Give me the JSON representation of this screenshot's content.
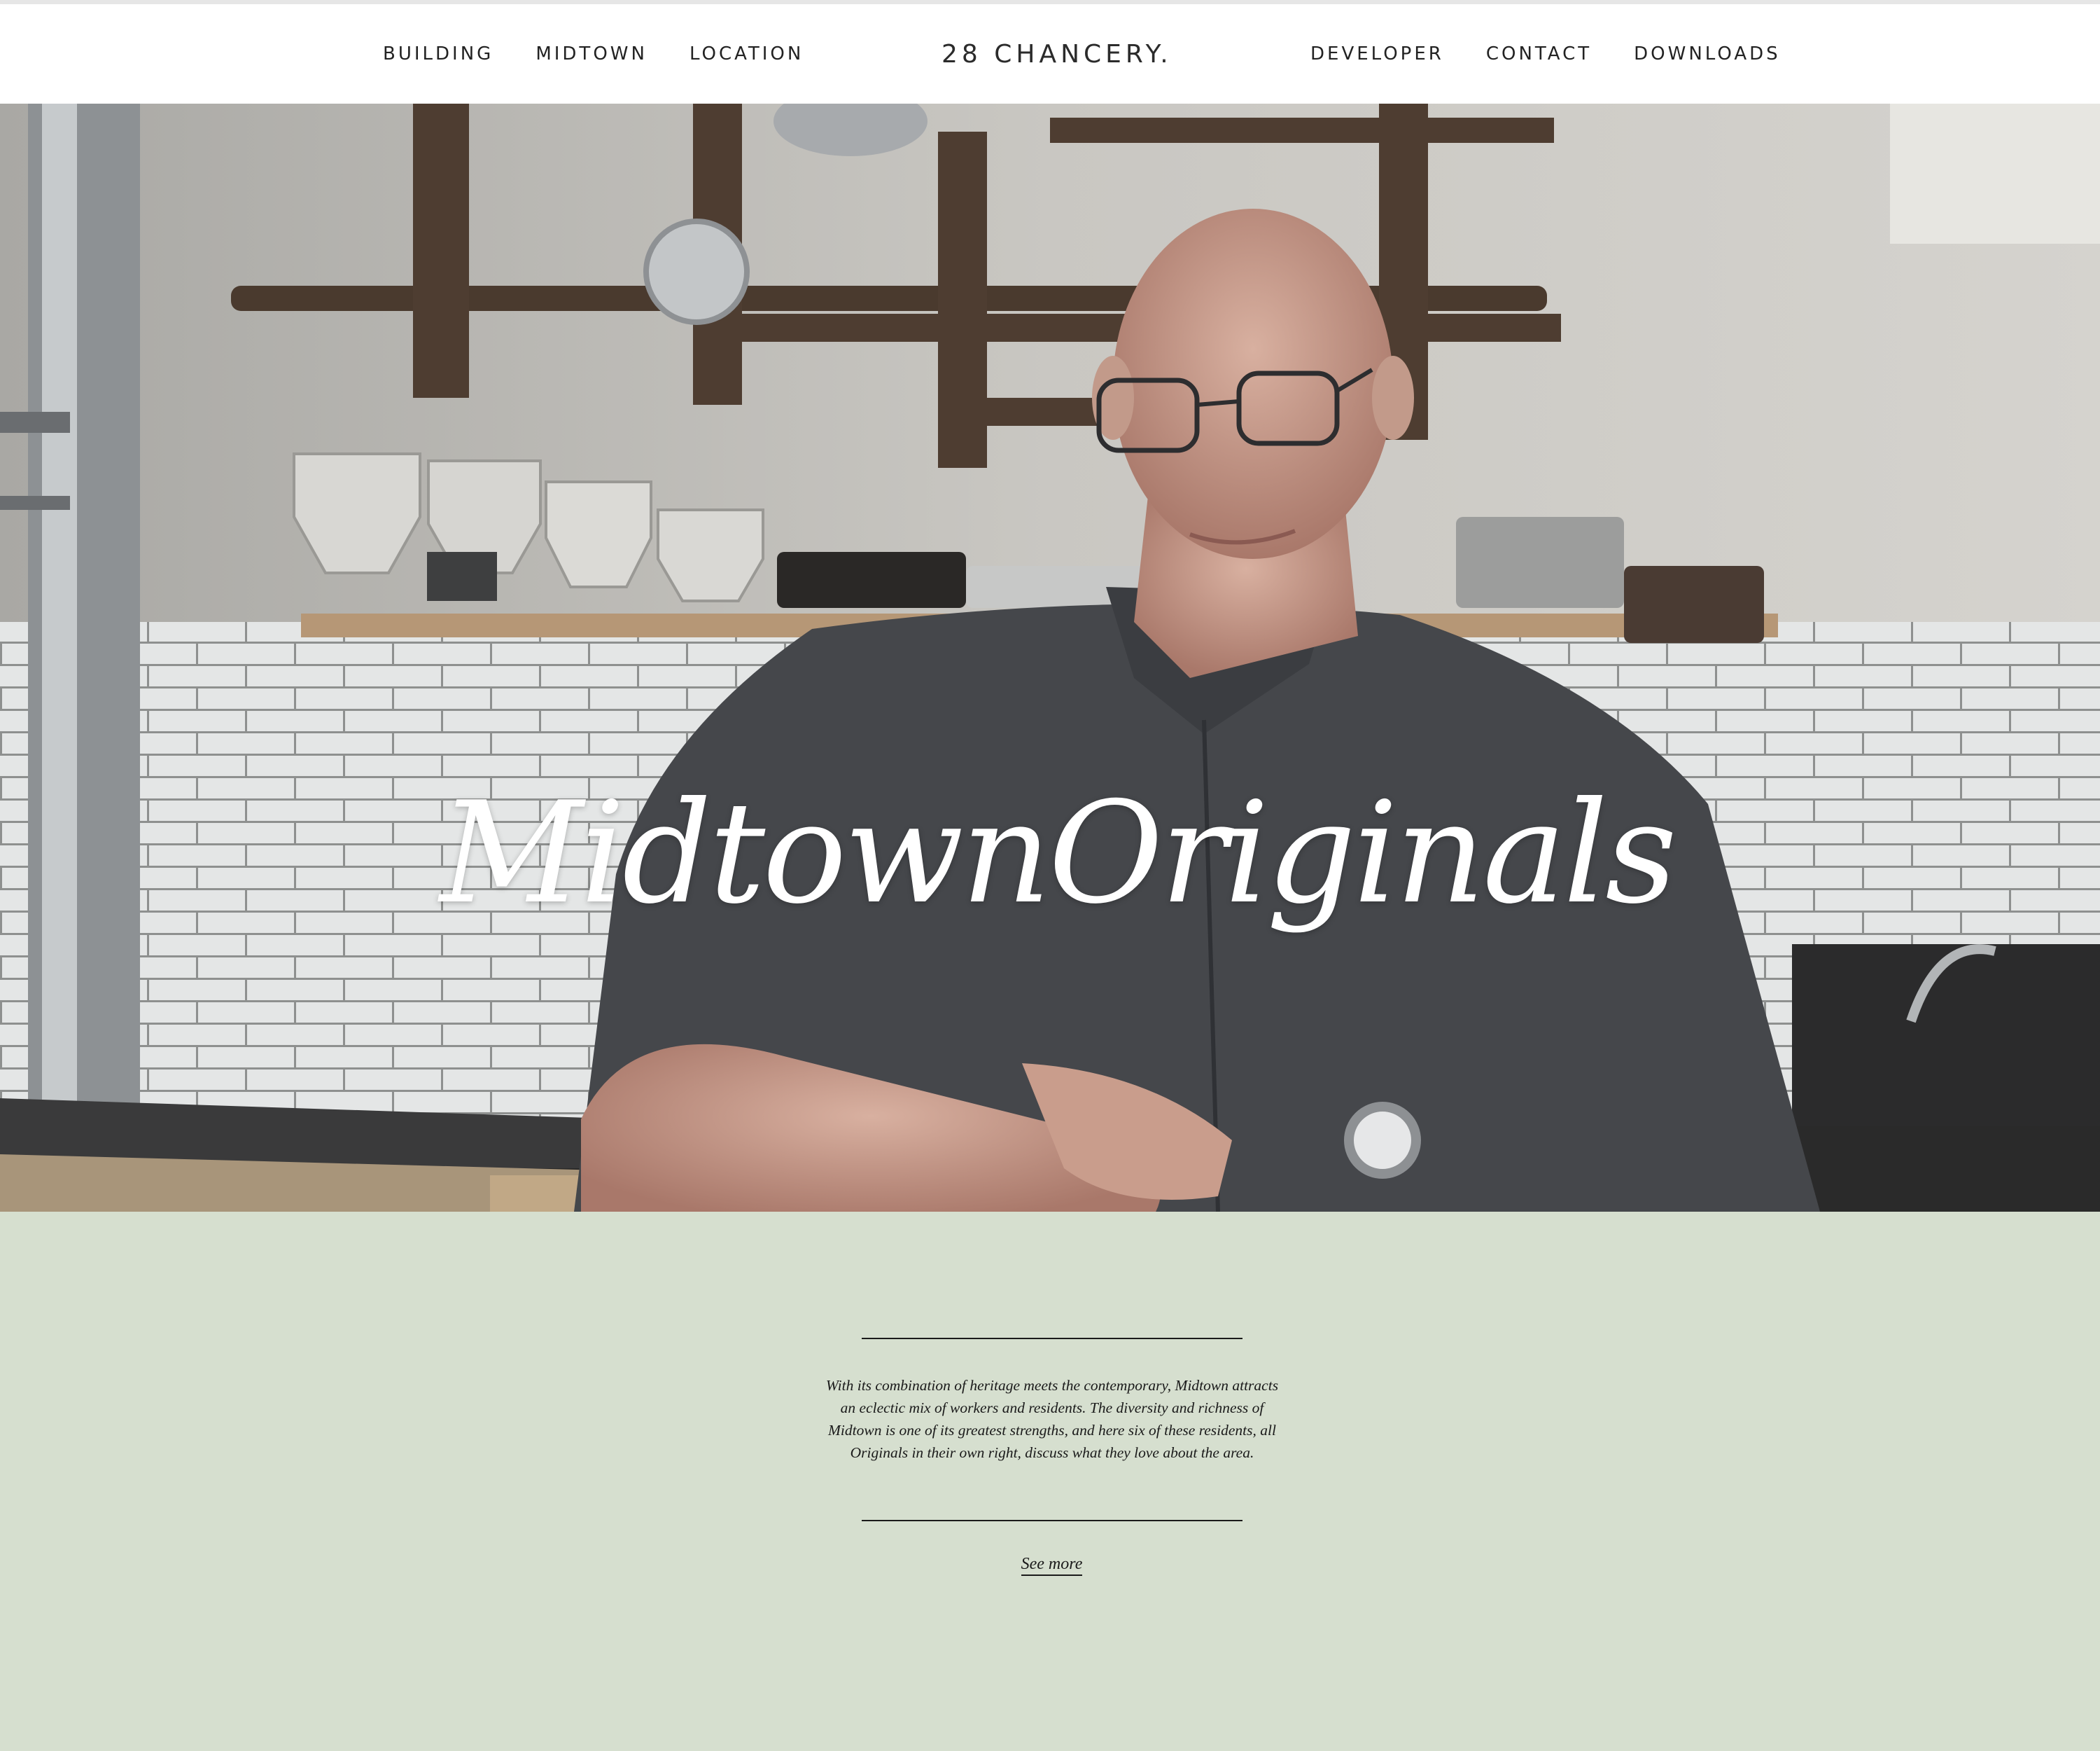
{
  "nav": {
    "left": [
      {
        "label": "BUILDING"
      },
      {
        "label": "MIDTOWN"
      },
      {
        "label": "LOCATION"
      }
    ],
    "right": [
      {
        "label": "DEVELOPER"
      },
      {
        "label": "CONTACT"
      },
      {
        "label": "DOWNLOADS"
      }
    ]
  },
  "logo": {
    "text": "28 CHANCERY."
  },
  "hero": {
    "title": "MidtownOriginals"
  },
  "intro": {
    "body": "With its combination of heritage meets the contemporary, Midtown attracts an eclectic mix of workers and residents. The diversity and richness of Midtown is one of its greatest strengths, and here six of these residents, all Originals in their own right, discuss what they love about the area.",
    "link_label": "See more"
  },
  "colors": {
    "header_bg": "#ffffff",
    "intro_bg": "#d6dfcf",
    "text": "#1a1a1a"
  }
}
